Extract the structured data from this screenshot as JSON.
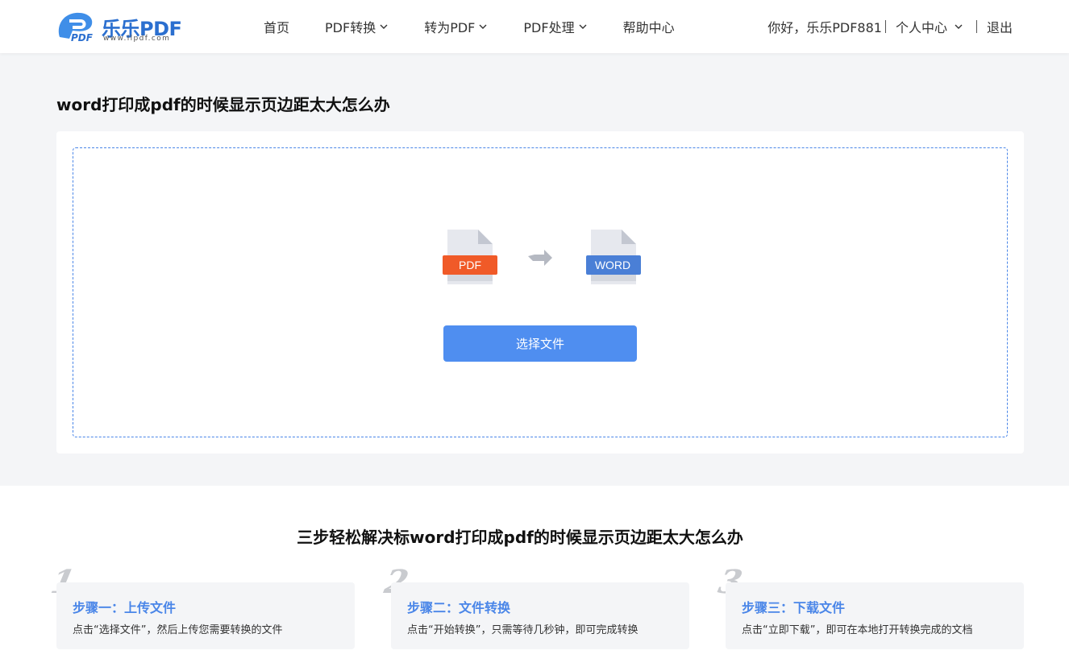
{
  "header": {
    "logo_name": "乐乐PDF",
    "logo_url": "www.llpdf.com",
    "nav": [
      {
        "label": "首页",
        "dropdown": false
      },
      {
        "label": "PDF转换",
        "dropdown": true
      },
      {
        "label": "转为PDF",
        "dropdown": true
      },
      {
        "label": "PDF处理",
        "dropdown": true
      },
      {
        "label": "帮助中心",
        "dropdown": false
      }
    ],
    "greeting": "你好，乐乐PDF881",
    "user_center": "个人中心",
    "logout": "退出"
  },
  "main": {
    "title": "word打印成pdf的时候显示页边距太大怎么办",
    "from_format": "PDF",
    "to_format": "WORD",
    "select_button": "选择文件"
  },
  "steps": {
    "title": "三步轻松解决标word打印成pdf的时候显示页边距太大怎么办",
    "items": [
      {
        "num": "1",
        "heading": "步骤一：上传文件",
        "desc": "点击“选择文件”，然后上传您需要转换的文件"
      },
      {
        "num": "2",
        "heading": "步骤二：文件转换",
        "desc": "点击“开始转换”，只需等待几秒钟，即可完成转换"
      },
      {
        "num": "3",
        "heading": "步骤三：下载文件",
        "desc": "点击“立即下载”，即可在本地打开转换完成的文档"
      }
    ]
  },
  "colors": {
    "brand": "#2b6fcf",
    "accent": "#4f8ef0",
    "pdf": "#f05a28",
    "word": "#4a7fd6"
  }
}
